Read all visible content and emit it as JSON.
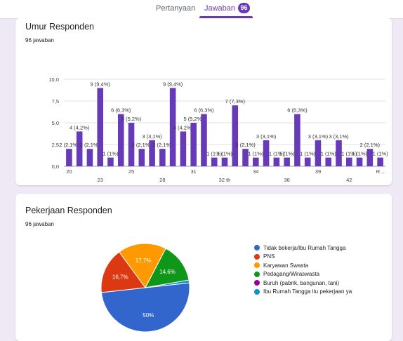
{
  "tabs": [
    {
      "label": "Pertanyaan"
    },
    {
      "label": "Jawaban",
      "badge": "96"
    }
  ],
  "card1": {
    "title": "Umur Responden",
    "subtitle": "96 jawaban"
  },
  "card2": {
    "title": "Pekerjaan Responden",
    "subtitle": "96 jawaban"
  },
  "colors": {
    "accent": "#673ab7",
    "bar": "#673ab7"
  },
  "chart_data": [
    {
      "type": "bar",
      "ylim": [
        0,
        10
      ],
      "yticks": [
        "10,0",
        "7,5",
        "5,0",
        "2,5",
        "0,0"
      ],
      "xticks": [
        "20",
        "23",
        "25",
        "28",
        "31",
        "32 th",
        "34",
        "36",
        "39",
        "42",
        "R..."
      ],
      "values": [
        2,
        4,
        2,
        9,
        1,
        6,
        5,
        2,
        3,
        2,
        9,
        4,
        5,
        6,
        1,
        1,
        7,
        2,
        1,
        3,
        1,
        1,
        6,
        1,
        3,
        1,
        3,
        1,
        1,
        2,
        1
      ],
      "data_labels": [
        "2 (2,1%)",
        "4 (4,2%)",
        "2 (2,1%)",
        "9 (9,4%)",
        "1 (1%)",
        "6 (6,3%)",
        "5 (5,2%)",
        "2 (2,1%)",
        "3 (3,1%)",
        "2 (2,1%)",
        "9 (9,4%)",
        "4 (4,2%)",
        "5 (5,2%)",
        "6 (6,3%)",
        "1 (1%)",
        "1 (1%)",
        "7 (7,3%)",
        "2 (2,1%)",
        "1 (1%)",
        "3 (3,1%)",
        "1 (1%)",
        "1 (1%)",
        "6 (6,3%)",
        "1 (1%)",
        "3 (3,1%)",
        "1 (1%)",
        "3 (3,1%)",
        "1 (1%)",
        "1 (1%)",
        "2 (2,1%)",
        "1 (1%)"
      ]
    },
    {
      "type": "pie",
      "slices": [
        {
          "label": "Tidak bekerja/Ibu Rumah Tangga",
          "value": 50.0,
          "percent_label": "50%",
          "color": "#3366cc"
        },
        {
          "label": "PNS",
          "value": 16.7,
          "percent_label": "16,7%",
          "color": "#dc3912"
        },
        {
          "label": "Karyawan Swasta",
          "value": 17.7,
          "percent_label": "17,7%",
          "color": "#ff9900"
        },
        {
          "label": "Pedagang/Wiraswasta",
          "value": 14.6,
          "percent_label": "14,6%",
          "color": "#109618"
        },
        {
          "label": "Buruh (pabrik, bangunan, tani)",
          "value": 0,
          "percent_label": "",
          "color": "#990099"
        },
        {
          "label": "Ibu Rumah Tangga itu pekerjaan ya",
          "value": 1.0,
          "percent_label": "",
          "color": "#0099c6"
        }
      ]
    }
  ]
}
